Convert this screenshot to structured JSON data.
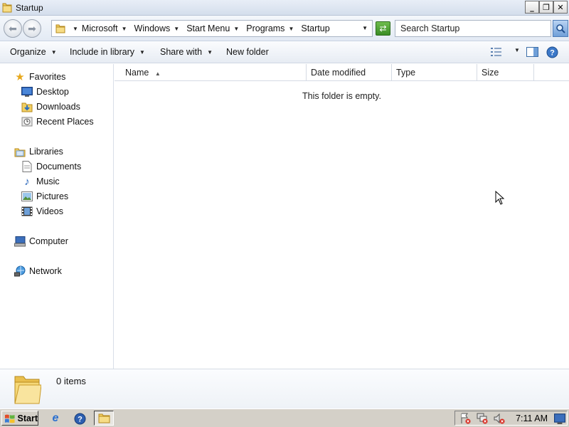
{
  "window": {
    "title": "Startup"
  },
  "address_bar": {
    "breadcrumbs": [
      "Microsoft",
      "Windows",
      "Start Menu",
      "Programs",
      "Startup"
    ],
    "search_placeholder": "Search Startup"
  },
  "command_bar": {
    "organize": "Organize",
    "include_in_library": "Include in library",
    "share_with": "Share with",
    "new_folder": "New folder"
  },
  "nav_pane": {
    "favorites": {
      "label": "Favorites",
      "items": [
        "Desktop",
        "Downloads",
        "Recent Places"
      ]
    },
    "libraries": {
      "label": "Libraries",
      "items": [
        "Documents",
        "Music",
        "Pictures",
        "Videos"
      ]
    },
    "computer": "Computer",
    "network": "Network"
  },
  "file_list": {
    "columns": [
      "Name",
      "Date modified",
      "Type",
      "Size"
    ],
    "sort_column": "Name",
    "empty_message": "This folder is empty."
  },
  "details_pane": {
    "item_count": "0 items"
  },
  "taskbar": {
    "start_label": "Start",
    "clock": "7:11 AM"
  },
  "icons": {
    "window": "folder-icon",
    "back": "back-arrow-icon",
    "forward": "forward-arrow-icon",
    "refresh": "refresh-icon",
    "search": "magnifier-icon",
    "view": "details-view-icon",
    "preview_pane": "preview-pane-icon",
    "help": "help-icon"
  }
}
